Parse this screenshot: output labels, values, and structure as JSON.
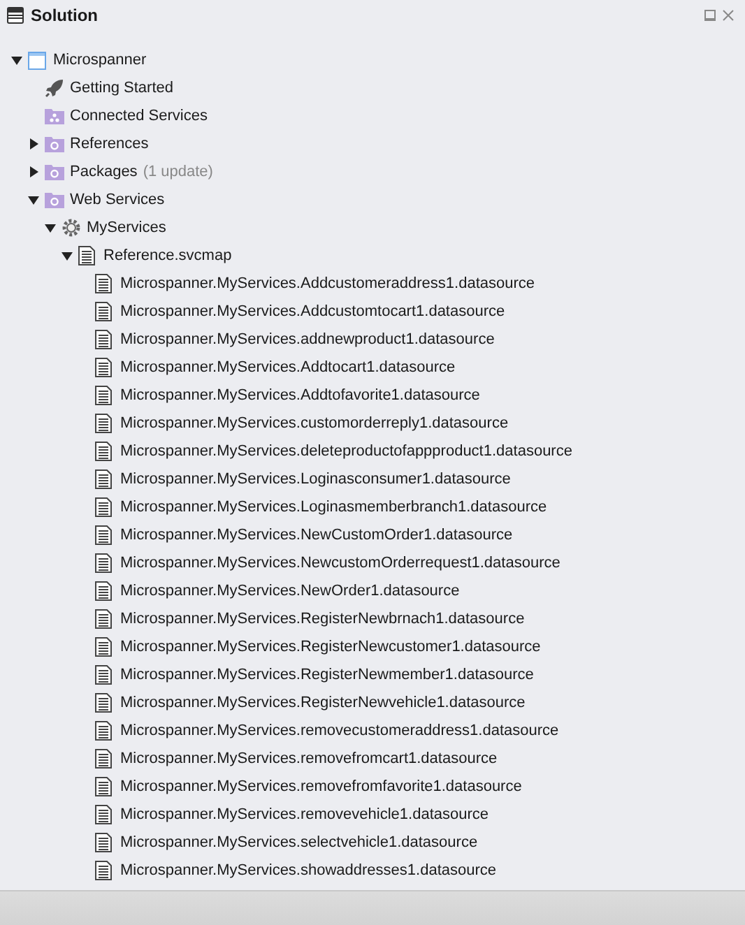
{
  "panel": {
    "title": "Solution"
  },
  "tree": [
    {
      "label": "Microspanner",
      "kind": "project",
      "expanded": true,
      "children": [
        {
          "label": "Getting Started",
          "kind": "rocket"
        },
        {
          "label": "Connected Services",
          "kind": "services-folder"
        },
        {
          "label": "References",
          "kind": "folder",
          "expanded": false
        },
        {
          "label": "Packages",
          "note": "(1 update)",
          "kind": "folder",
          "expanded": false
        },
        {
          "label": "Web Services",
          "kind": "folder",
          "expanded": true,
          "children": [
            {
              "label": "MyServices",
              "kind": "gear",
              "expanded": true,
              "children": [
                {
                  "label": "Reference.svcmap",
                  "kind": "document",
                  "expanded": true,
                  "children": [
                    {
                      "label": "Microspanner.MyServices.Addcustomeraddress1.datasource",
                      "kind": "document"
                    },
                    {
                      "label": "Microspanner.MyServices.Addcustomtocart1.datasource",
                      "kind": "document"
                    },
                    {
                      "label": "Microspanner.MyServices.addnewproduct1.datasource",
                      "kind": "document"
                    },
                    {
                      "label": "Microspanner.MyServices.Addtocart1.datasource",
                      "kind": "document"
                    },
                    {
                      "label": "Microspanner.MyServices.Addtofavorite1.datasource",
                      "kind": "document"
                    },
                    {
                      "label": "Microspanner.MyServices.customorderreply1.datasource",
                      "kind": "document"
                    },
                    {
                      "label": "Microspanner.MyServices.deleteproductofappproduct1.datasource",
                      "kind": "document"
                    },
                    {
                      "label": "Microspanner.MyServices.Loginasconsumer1.datasource",
                      "kind": "document"
                    },
                    {
                      "label": "Microspanner.MyServices.Loginasmemberbranch1.datasource",
                      "kind": "document"
                    },
                    {
                      "label": "Microspanner.MyServices.NewCustomOrder1.datasource",
                      "kind": "document"
                    },
                    {
                      "label": "Microspanner.MyServices.NewcustomOrderrequest1.datasource",
                      "kind": "document"
                    },
                    {
                      "label": "Microspanner.MyServices.NewOrder1.datasource",
                      "kind": "document"
                    },
                    {
                      "label": "Microspanner.MyServices.RegisterNewbrnach1.datasource",
                      "kind": "document"
                    },
                    {
                      "label": "Microspanner.MyServices.RegisterNewcustomer1.datasource",
                      "kind": "document"
                    },
                    {
                      "label": "Microspanner.MyServices.RegisterNewmember1.datasource",
                      "kind": "document"
                    },
                    {
                      "label": "Microspanner.MyServices.RegisterNewvehicle1.datasource",
                      "kind": "document"
                    },
                    {
                      "label": "Microspanner.MyServices.removecustomeraddress1.datasource",
                      "kind": "document"
                    },
                    {
                      "label": "Microspanner.MyServices.removefromcart1.datasource",
                      "kind": "document"
                    },
                    {
                      "label": "Microspanner.MyServices.removefromfavorite1.datasource",
                      "kind": "document"
                    },
                    {
                      "label": "Microspanner.MyServices.removevehicle1.datasource",
                      "kind": "document"
                    },
                    {
                      "label": "Microspanner.MyServices.selectvehicle1.datasource",
                      "kind": "document"
                    },
                    {
                      "label": "Microspanner.MyServices.showaddresses1.datasource",
                      "kind": "document"
                    }
                  ]
                }
              ]
            }
          ]
        }
      ]
    }
  ]
}
